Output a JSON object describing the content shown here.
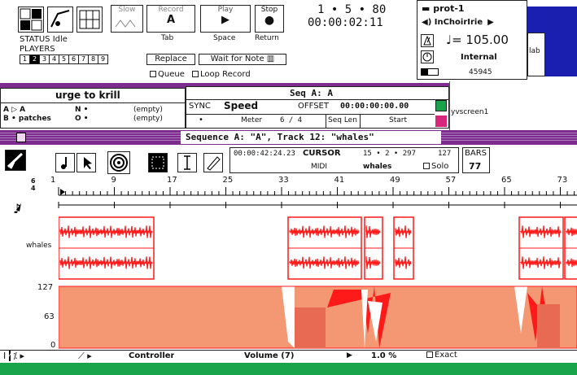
{
  "transport": {
    "status_label": "STATUS Idle",
    "players_label": "PLAYERS",
    "player_nums": [
      "1",
      "2",
      "3",
      "4",
      "5",
      "6",
      "7",
      "8",
      "9"
    ],
    "buttons": [
      {
        "top": "Slow",
        "bottom": ""
      },
      {
        "top": "Record",
        "bottom": "Tab",
        "big": "A"
      },
      {
        "top": "Play",
        "bottom": "Space"
      },
      {
        "top": "Stop",
        "bottom": "Return"
      }
    ],
    "replace_label": "Replace",
    "wait_label": "Wait for Note",
    "queue_label": "Queue",
    "loop_label": "Loop Record",
    "position": "1 • 5 • 80",
    "time": "00:00:02:11"
  },
  "right_panel": {
    "device": "prot-1",
    "instrument": "InChoirIrie",
    "tempo": "♩= 105.00",
    "tempo_source": "Internal",
    "counter": "45945",
    "side_tab": "lab",
    "stub": "yvscreen1"
  },
  "chunks": {
    "title": "urge to krill",
    "rows": [
      {
        "a": "A ▷ A",
        "n": "N •",
        "v": "(empty)"
      },
      {
        "a": "B • patches",
        "n": "O •",
        "v": "(empty)"
      }
    ]
  },
  "seq_info": {
    "title": "Seq A: A",
    "sync": "SYNC",
    "speed": "Speed",
    "offset_label": "OFFSET",
    "offset": "00:00:00:00.00",
    "dot": "•",
    "meter_label": "Meter",
    "meter": "6 / 4",
    "seqlen": "Seq Len",
    "start": "Start"
  },
  "track_window": {
    "title": "Sequence A: \"A\", Track 12: \"whales\"",
    "time": "00:00:42:24.23",
    "cursor_label": "CURSOR",
    "cursor_pos": "15 • 2 • 297",
    "cursor_ticks": "127",
    "midi_label": "MIDI",
    "track_name": "whales",
    "solo_label": "Solo",
    "bars_label": "BARS",
    "bars_value": "77",
    "ruler": [
      "1",
      "9",
      "17",
      "25",
      "33",
      "41",
      "49",
      "57",
      "65",
      "73"
    ],
    "time_sig_top": "6",
    "time_sig_bottom": "4",
    "track_label": "whales",
    "ctrl_values": [
      "127",
      "63",
      "0"
    ],
    "footer": {
      "controller": "Controller",
      "volume": "Volume (7)",
      "percent": "1.0 %",
      "exact": "Exact"
    }
  },
  "colors": {
    "accent": "#7b2c8c",
    "wave": "#ff1a1a",
    "ctrl": "#f39873",
    "green": "#19a34a",
    "blue": "#1b1fb0"
  }
}
